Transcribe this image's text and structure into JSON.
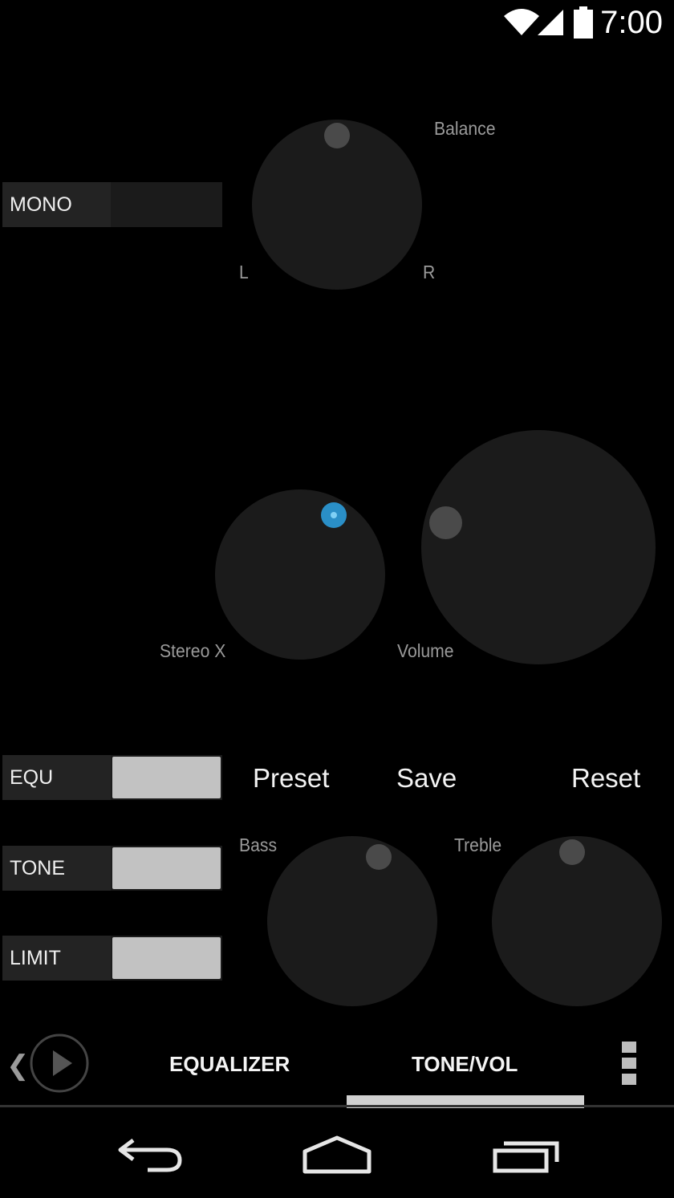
{
  "status_bar": {
    "time": "7:00",
    "icons": [
      "wifi-icon",
      "cell-signal-icon",
      "battery-icon"
    ]
  },
  "balance": {
    "label": "Balance",
    "left_label": "L",
    "right_label": "R"
  },
  "mono_toggle": {
    "label": "MONO"
  },
  "stereo_x": {
    "label": "Stereo X"
  },
  "volume": {
    "label": "Volume"
  },
  "toggles": [
    {
      "label": "EQU"
    },
    {
      "label": "TONE"
    },
    {
      "label": "LIMIT"
    }
  ],
  "actions": {
    "preset": "Preset",
    "save": "Save",
    "reset": "Reset"
  },
  "bass": {
    "label": "Bass"
  },
  "treble": {
    "label": "Treble"
  },
  "tabs": [
    {
      "label": "EQUALIZER",
      "selected": false
    },
    {
      "label": "TONE/VOL",
      "selected": true
    }
  ],
  "colors": {
    "background": "#000000",
    "knob": "#1b1b1b",
    "accent": "#2a8fc7",
    "toggle_on": "#c2c2c2"
  }
}
